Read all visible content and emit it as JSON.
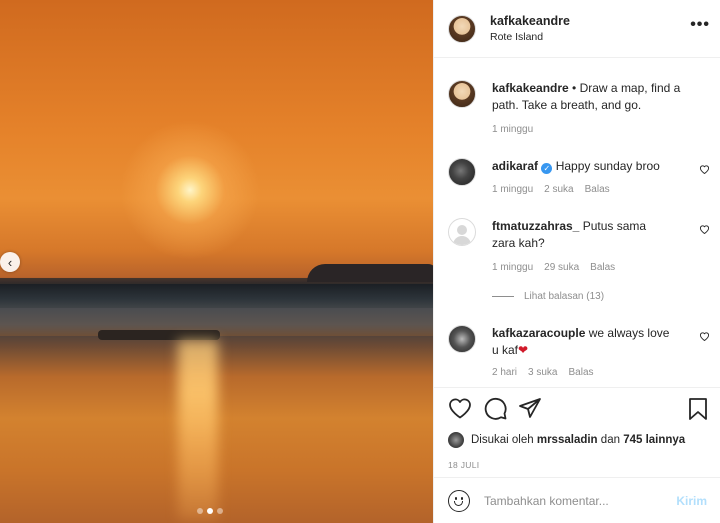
{
  "post": {
    "username": "kafkakeandre",
    "location": "Rote Island",
    "more_glyph": "•••",
    "prev_glyph": "‹",
    "caption_user": "kafkakeandre",
    "caption_sep": " • ",
    "caption_text": "Draw a map, find a path. Take a breath, and go.",
    "caption_time": "1 minggu",
    "carousel_count": 3,
    "carousel_active": 2
  },
  "comments": [
    {
      "user": "adikaraf",
      "verified": true,
      "text": "Happy sunday broo",
      "time": "1 minggu",
      "likes": "2 suka",
      "reply": "Balas"
    },
    {
      "user": "ftmatuzzahras_",
      "verified": false,
      "text": "Putus sama zara kah?",
      "time": "1 minggu",
      "likes": "29 suka",
      "reply": "Balas"
    },
    {
      "user": "kafkazaracouple",
      "verified": false,
      "text": "we always love u kaf",
      "emoji": "❤",
      "time": "2 hari",
      "likes": "3 suka",
      "reply": "Balas"
    }
  ],
  "view_replies": "Lihat balasan (13)",
  "likes": {
    "prefix": "Disukai oleh ",
    "user": "mrssaladin",
    "middle": " dan ",
    "count": "745 lainnya"
  },
  "date": "18 JULI",
  "add_comment": {
    "placeholder": "Tambahkan komentar...",
    "post_label": "Kirim"
  },
  "icons": [
    "heart-icon",
    "comment-icon",
    "share-icon",
    "bookmark-icon",
    "emoji-icon",
    "verified-icon",
    "more-icon",
    "chevron-left-icon"
  ],
  "colors": {
    "link_blue": "#3897f0",
    "post_disabled": "#b2dffc",
    "meta_gray": "#8e8e8e",
    "heart_red": "#d11a2a"
  }
}
